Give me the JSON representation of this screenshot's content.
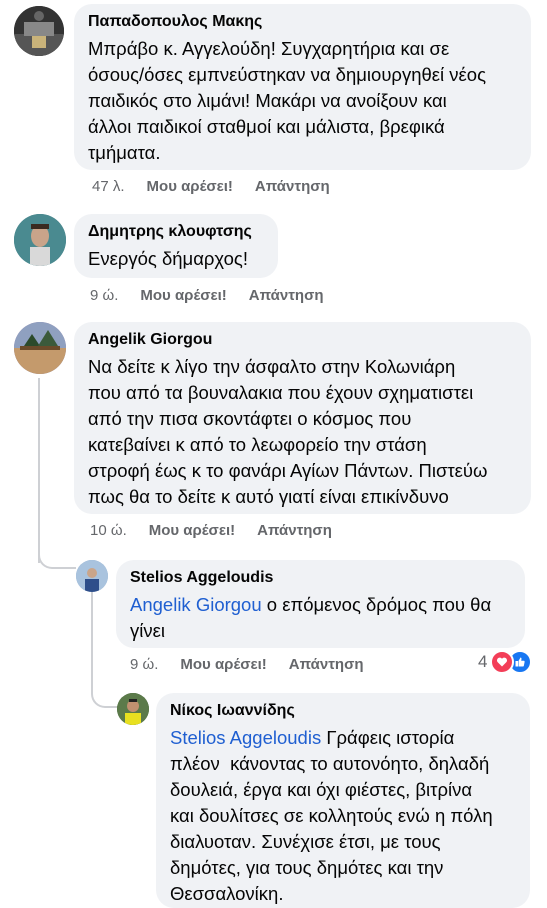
{
  "comments": [
    {
      "author": "Παπαδοπουλος Μακης",
      "lines": [
        "Μπράβο κ. Αγγελούδη! Συγχαρητήρια και σε",
        "όσους/όσες εμπνεύστηκαν να δημιουργηθεί νέος",
        "παιδικός στο λιμάνι! Μακάρι να ανοίξουν και",
        "άλλοι παιδικοί σταθμοί και μάλιστα, βρεφικά",
        "τμήματα."
      ],
      "time": "47 λ.",
      "like": "Μου αρέσει!",
      "reply": "Απάντηση"
    },
    {
      "author": "Δημητρης κλουφτσης",
      "lines": [
        "Ενεργός δήμαρχος!"
      ],
      "time": "9 ώ.",
      "like": "Μου αρέσει!",
      "reply": "Απάντηση"
    },
    {
      "author": "Angelik Giorgou",
      "lines": [
        "Να δείτε κ λίγο την άσφαλτο στην Κολωνιάρη",
        "που από τα βουναλακια που έχουν σχηματιστει",
        "από την πισα σκοντάφτει ο κόσμος που",
        "κατεβαίνει κ από το λεωφορείο την στάση",
        "στροφή έως κ το φανάρι Αγίων Πάντων. Πιστεύω",
        "πως θα το δείτε κ αυτό γιατί είναι επικίνδυνο"
      ],
      "time": "10 ώ.",
      "like": "Μου αρέσει!",
      "reply": "Απάντηση"
    }
  ],
  "reply1": {
    "author": "Stelios Aggeloudis",
    "mention": "Angelik Giorgou",
    "line1_rest": " ο επόμενος δρόμος που θα",
    "line2": "γίνει",
    "time": "9 ώ.",
    "like": "Μου αρέσει!",
    "reply": "Απάντηση",
    "reaction_count": "4",
    "reaction_icons": [
      "heart-icon",
      "like-icon"
    ],
    "colors": {
      "heart": "#f33e58",
      "like": "#1877f2"
    }
  },
  "reply2": {
    "author": "Νίκος Ιωαννίδης",
    "mention": "Stelios Aggeloudis",
    "line1_rest": " Γράφεις ιστορία",
    "lines": [
      "πλέον  κάνοντας το αυτονόητο, δηλαδή",
      "δουλειά, έργα και όχι φιέστες, βιτρίνα",
      "και δουλίτσες σε κολλητούς ενώ η πόλη",
      "διαλυοταν. Συνέχισε έτσι, με τους",
      "δημότες, για τους δημότες και την",
      "Θεσσαλονίκη."
    ]
  }
}
